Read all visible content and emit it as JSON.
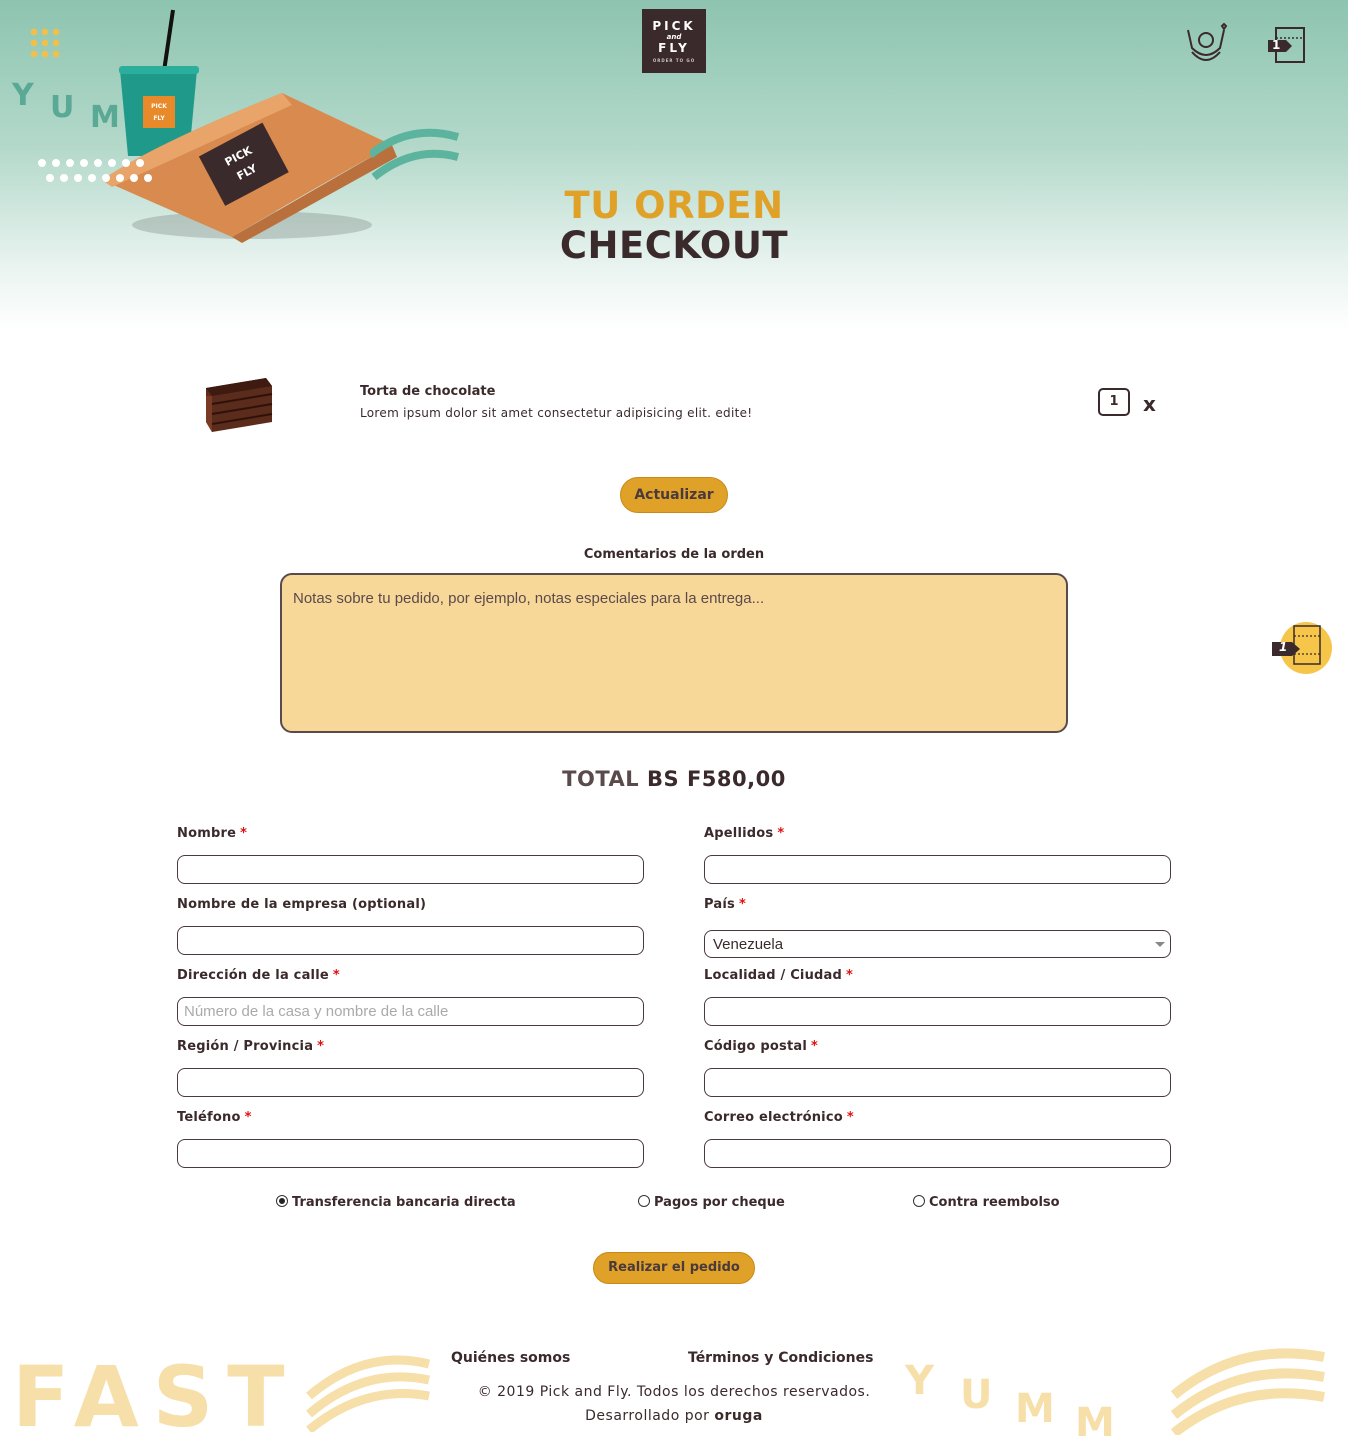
{
  "header": {
    "logo": {
      "line1": "PICK",
      "line2": "and",
      "line3": "FLY",
      "tagline": "ORDER TO GO"
    },
    "decor_text": "YUMM",
    "user_icon": "chef-user-icon",
    "cart_icon": "cart-bag-icon",
    "cart_count": "1"
  },
  "page": {
    "title_line1": "TU ORDEN",
    "title_line2": "CHECKOUT"
  },
  "cart": {
    "items": [
      {
        "name": "Torta de chocolate",
        "description": "Lorem ipsum dolor sit amet consectetur adipisicing elit. edite!",
        "quantity": "1",
        "remove_label": "x",
        "image_icon": "chocolate-cake-image"
      }
    ],
    "update_button": "Actualizar"
  },
  "comments": {
    "label": "Comentarios de la orden",
    "placeholder": "Notas sobre tu pedido, por ejemplo, notas especiales para la entrega..."
  },
  "floating_cart": {
    "count": "1",
    "icon": "cart-bag-icon"
  },
  "total": {
    "label": "TOTAL",
    "value": "BS F580,00"
  },
  "form": {
    "first_name": {
      "label": "Nombre",
      "required": "*",
      "value": ""
    },
    "last_name": {
      "label": "Apellidos",
      "required": "*",
      "value": ""
    },
    "company": {
      "label": "Nombre de la empresa (optional)",
      "value": ""
    },
    "country": {
      "label": "País",
      "required": "*",
      "value": "Venezuela"
    },
    "street": {
      "label": "Dirección de la calle",
      "required": "*",
      "placeholder": "Número de la casa y nombre de la calle"
    },
    "city": {
      "label": "Localidad / Ciudad",
      "required": "*",
      "value": ""
    },
    "region": {
      "label": "Región / Provincia",
      "required": "*",
      "value": ""
    },
    "postal": {
      "label": "Código postal",
      "required": "*",
      "value": ""
    },
    "phone": {
      "label": "Teléfono",
      "required": "*",
      "value": ""
    },
    "email": {
      "label": "Correo electrónico",
      "required": "*",
      "value": ""
    }
  },
  "payment": {
    "options": [
      {
        "label": "Transferencia bancaria directa",
        "selected": true
      },
      {
        "label": "Pagos por cheque",
        "selected": false
      },
      {
        "label": "Contra reembolso",
        "selected": false
      }
    ],
    "submit_button": "Realizar el pedido"
  },
  "footer": {
    "links": [
      "Quiénes somos",
      "Términos y Condiciones"
    ],
    "copyright": "© 2019 Pick and Fly. Todos los derechos reservados.",
    "developed_prefix": "Desarrollado por",
    "developer": "oruga",
    "decor_fast": "FAST",
    "decor_yumm": "YUMM"
  },
  "colors": {
    "accent": "#e0a128",
    "dark": "#3b2a2c",
    "teal": "#8dc4b0",
    "comment_bg": "#f8d898",
    "decor_light": "#f6dfa8"
  }
}
